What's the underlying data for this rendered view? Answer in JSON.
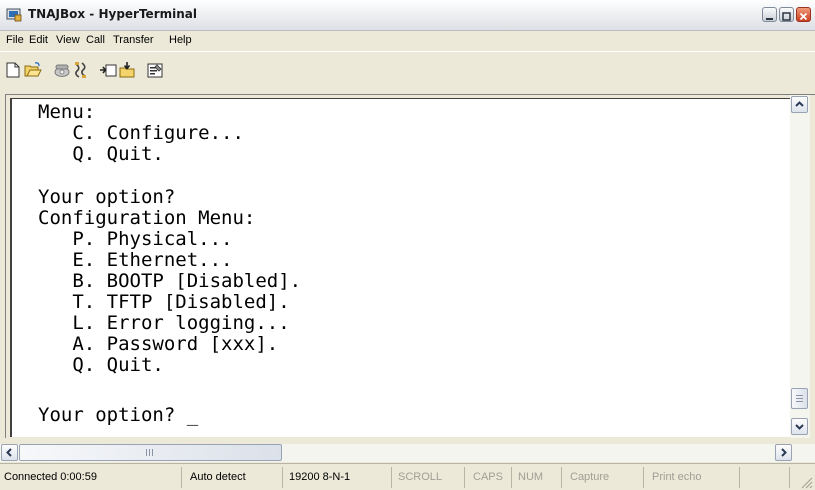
{
  "window": {
    "title": "TNAJBox - HyperTerminal"
  },
  "menu": [
    "File",
    "Edit",
    "View",
    "Call",
    "Transfer",
    "Help"
  ],
  "toolbar": [
    {
      "icon": "new-file-icon",
      "label": "New"
    },
    {
      "icon": "open-folder-icon",
      "label": "Open"
    },
    {
      "icon": "phone-call-icon",
      "label": "Call"
    },
    {
      "icon": "disconnect-icon",
      "label": "Disconnect"
    },
    {
      "icon": "send-icon",
      "label": "Send"
    },
    {
      "icon": "receive-icon",
      "label": "Receive"
    },
    {
      "icon": "properties-icon",
      "label": "Properties"
    }
  ],
  "terminal": {
    "lines": [
      "Menu:",
      "   C. Configure...",
      "   Q. Quit.",
      "",
      "Your option?",
      "Configuration Menu:",
      "   P. Physical...",
      "   E. Ethernet...",
      "   B. BOOTP [Disabled].",
      "   T. TFTP [Disabled].",
      "   L. Error logging...",
      "   A. Password [xxx].",
      "   Q. Quit.",
      "",
      "Your option? _"
    ]
  },
  "status": {
    "connected": "Connected 0:00:59",
    "detect": "Auto detect",
    "settings": "19200 8-N-1",
    "scroll": "SCROLL",
    "caps": "CAPS",
    "num": "NUM",
    "capture": "Capture",
    "print_echo": "Print echo"
  }
}
